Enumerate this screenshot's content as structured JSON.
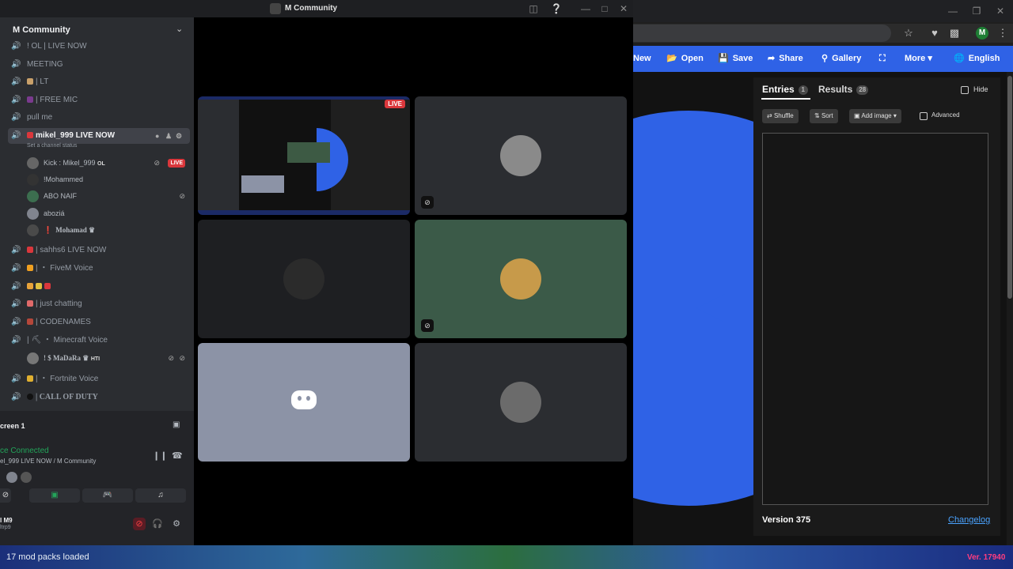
{
  "browser": {
    "toolbar": {
      "new": "New",
      "open": "Open",
      "save": "Save",
      "share": "Share",
      "gallery": "Gallery",
      "more": "More",
      "language": "English"
    },
    "profile_initial": "M",
    "panel": {
      "tab_entries": "Entries",
      "entries_count": "1",
      "tab_results": "Results",
      "results_count": "28",
      "hide_label": "Hide",
      "shuffle": "Shuffle",
      "sort": "Sort",
      "add_image": "Add image",
      "advanced": "Advanced",
      "version": "Version 375",
      "changelog": "Changelog"
    },
    "accent_color": "#2f62e6"
  },
  "discord": {
    "window_title": "M Community",
    "server_name": "M Community",
    "channels": [
      {
        "label": "! OL | LIVE NOW"
      },
      {
        "label": "MEETING"
      },
      {
        "label": "| LT"
      },
      {
        "label": "| FREE MIC"
      },
      {
        "label": "pull me"
      }
    ],
    "active_channel": {
      "label": "mikel_999 LIVE NOW",
      "status_hint": "Set a channel status"
    },
    "members": [
      {
        "name": "Kick : Mikel_999",
        "tag": "OL",
        "live": "LIVE"
      },
      {
        "name": "!Mohammed"
      },
      {
        "name": "ABO NAIF"
      },
      {
        "name": "aboziá"
      },
      {
        "name": "Mohamad ♛"
      }
    ],
    "channels_after": [
      {
        "label": "| sahhs6 LIVE NOW"
      },
      {
        "label": "| ・ FiveM Voice"
      },
      {
        "label": ""
      },
      {
        "label": "| just chatting"
      },
      {
        "label": "| CODENAMES"
      },
      {
        "label": "| ⛏ ・ Minecraft Voice"
      }
    ],
    "member_madara": {
      "name": "! $ MaDaRa ♛",
      "tag": "HTI"
    },
    "channels_tail": [
      {
        "label": "| ・ Fortnite Voice"
      },
      {
        "label": "| CALL OF DUTY"
      }
    ],
    "voice": {
      "screen_label": "creen 1",
      "connected": "ce Connected",
      "channel": "el_999 LIVE NOW / M Community"
    },
    "user": {
      "name": "l M9",
      "tag": "ltrp9"
    },
    "tile_live_badge": "LIVE"
  },
  "taskbar": {
    "status": "17 mod packs loaded",
    "version": "Ver. 17940"
  }
}
